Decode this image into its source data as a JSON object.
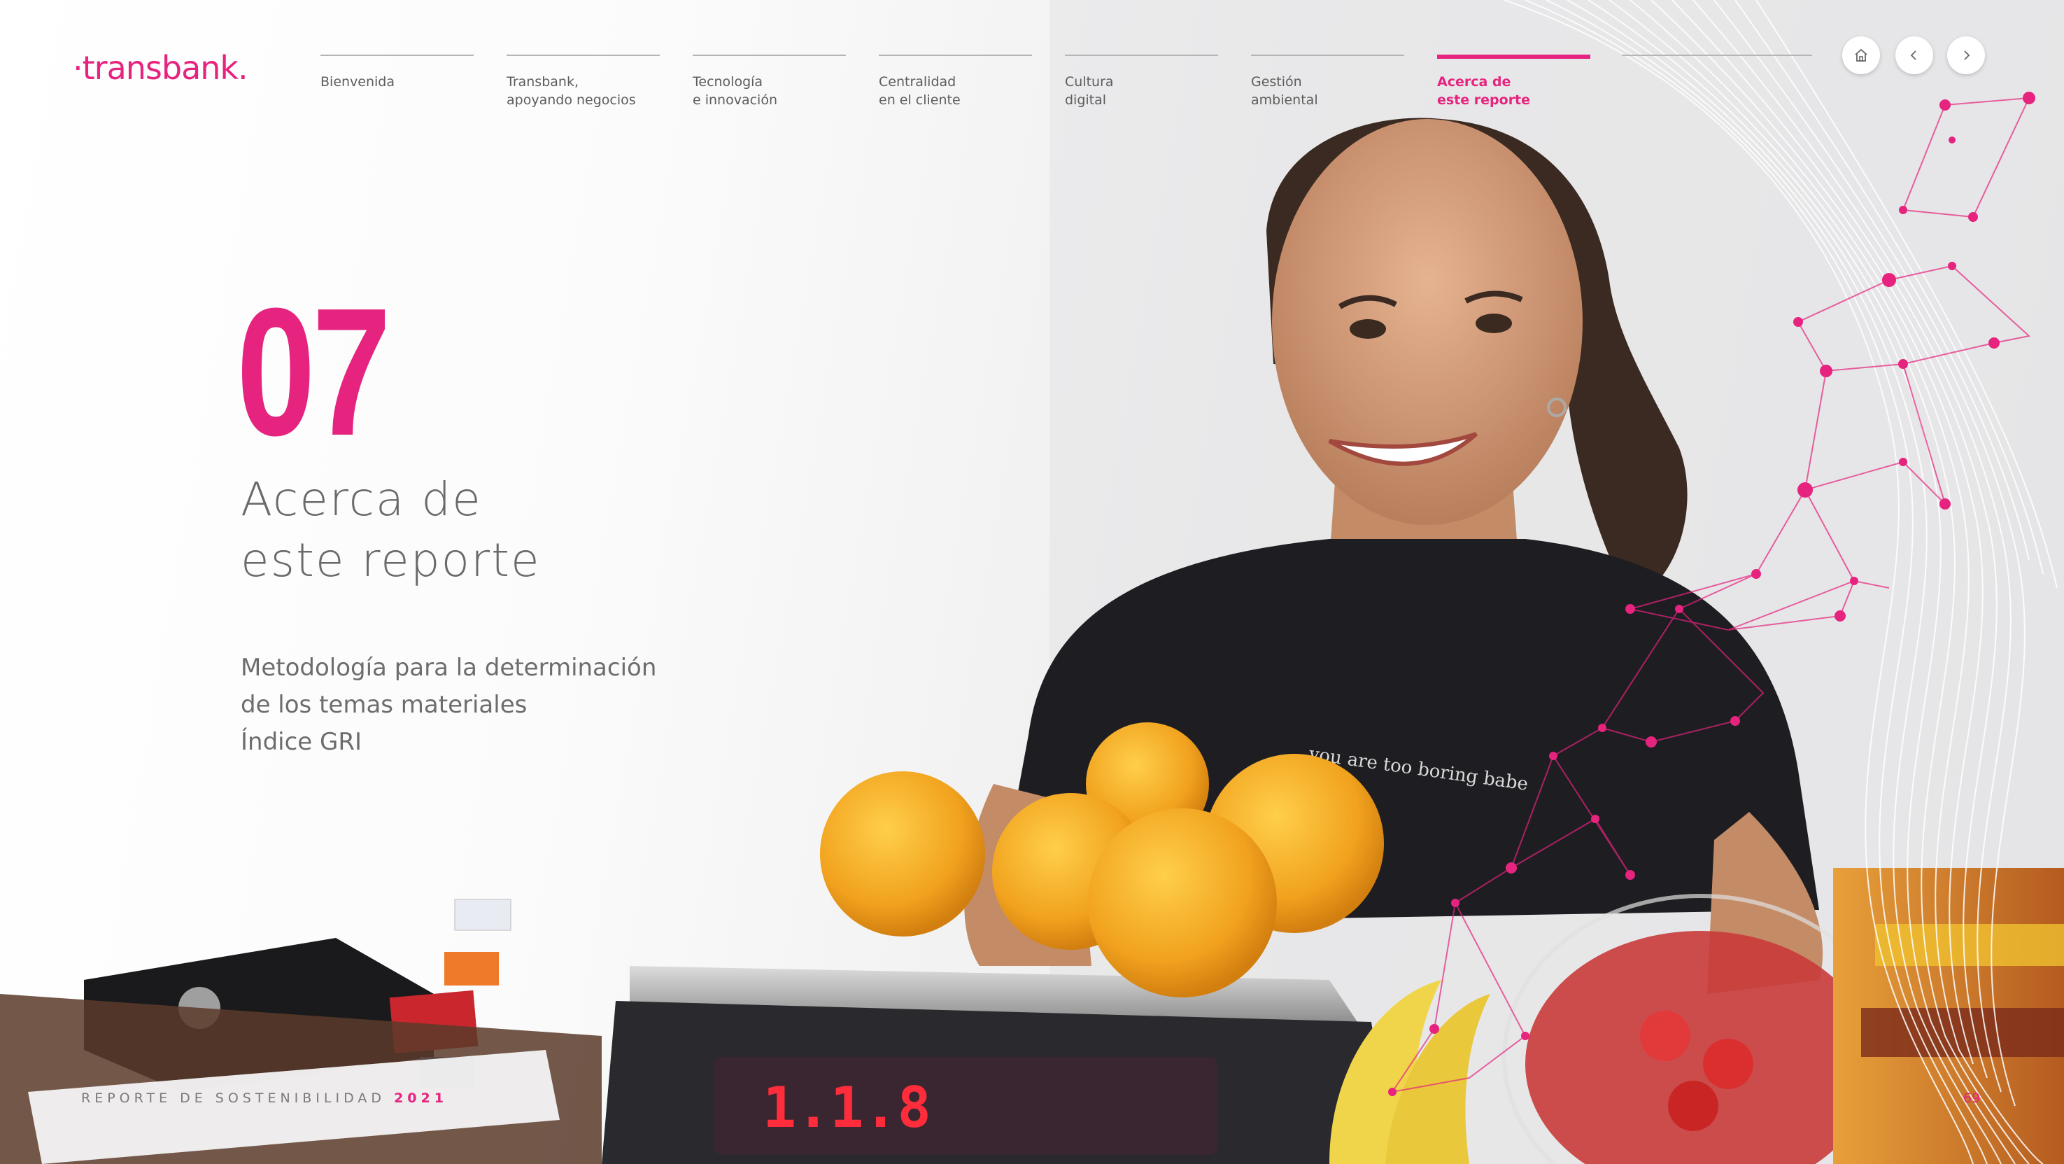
{
  "logo": {
    "text": "·transbank."
  },
  "nav": {
    "items": [
      {
        "line1": "Bienvenida",
        "line2": ""
      },
      {
        "line1": "Transbank,",
        "line2": "apoyando negocios"
      },
      {
        "line1": "Tecnología",
        "line2": "e innovación"
      },
      {
        "line1": "Centralidad",
        "line2": "en el cliente"
      },
      {
        "line1": "Cultura",
        "line2": "digital"
      },
      {
        "line1": "Gestión",
        "line2": "ambiental"
      },
      {
        "line1": "Acerca de",
        "line2": "este reporte"
      }
    ],
    "active_index": 6
  },
  "controls": {
    "home_icon": "home-icon",
    "prev_icon": "chevron-left-icon",
    "next_icon": "chevron-right-icon"
  },
  "chapter": {
    "number": "07",
    "title_line1": "Acerca de",
    "title_line2": "este reporte"
  },
  "links": [
    "Metodología para la determinación",
    "de los temas materiales",
    "Índice GRI"
  ],
  "footer": {
    "report_label": "REPORTE DE SOSTENIBILIDAD",
    "year": "2021",
    "page_number": "69"
  },
  "photo": {
    "shirt_text": "you are too boring babe",
    "scale_display": "1.1.8"
  },
  "colors": {
    "accent": "#e6237e",
    "text_gray": "#6a6a6a",
    "nav_line": "#b5b5b5"
  }
}
